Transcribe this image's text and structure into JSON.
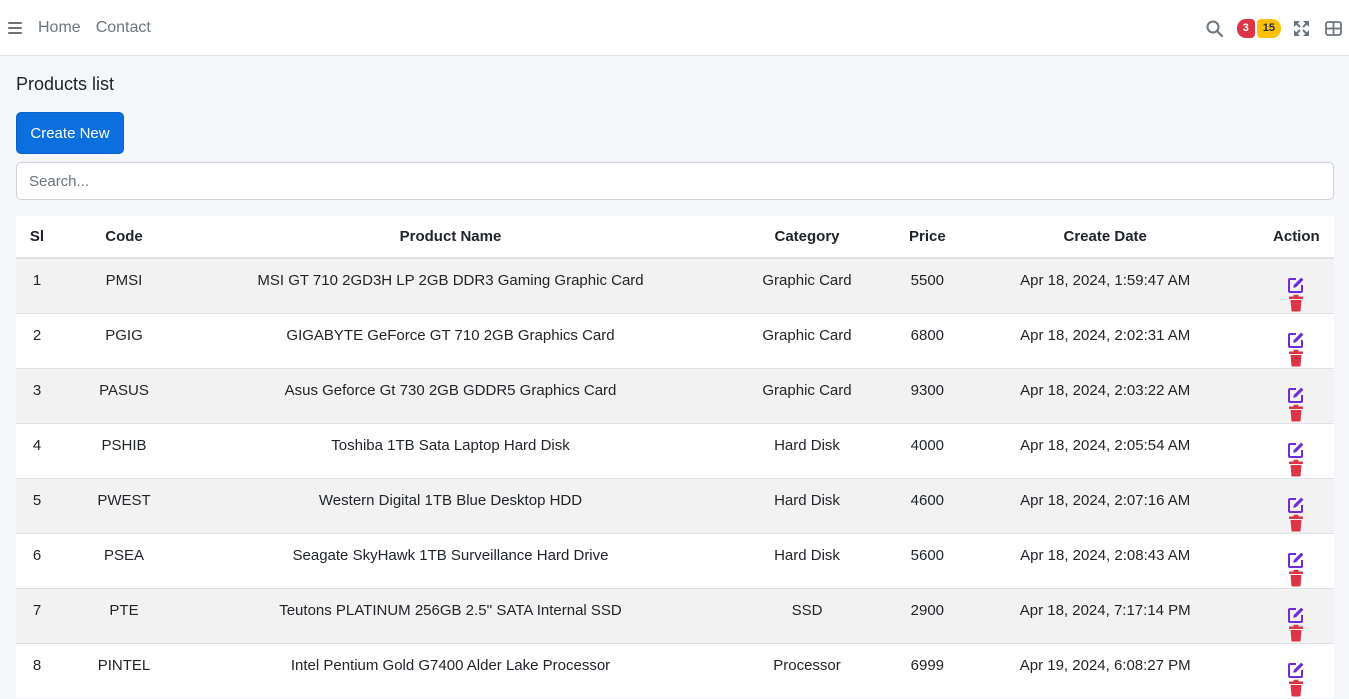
{
  "nav": {
    "links": [
      "Home",
      "Contact"
    ],
    "badge_messages": "3",
    "badge_notifications": "15"
  },
  "page": {
    "title": "Products list",
    "create_label": "Create New",
    "search_placeholder": "Search..."
  },
  "table": {
    "headers": [
      "Sl",
      "Code",
      "Product Name",
      "Category",
      "Price",
      "Create Date",
      "Action"
    ],
    "rows": [
      [
        "1",
        "PMSI",
        "MSI GT 710 2GD3H LP 2GB DDR3 Gaming Graphic Card",
        "Graphic Card",
        "5500",
        "Apr 18, 2024, 1:59:47 AM"
      ],
      [
        "2",
        "PGIG",
        "GIGABYTE GeForce GT 710 2GB Graphics Card",
        "Graphic Card",
        "6800",
        "Apr 18, 2024, 2:02:31 AM"
      ],
      [
        "3",
        "PASUS",
        "Asus Geforce Gt 730 2GB GDDR5 Graphics Card",
        "Graphic Card",
        "9300",
        "Apr 18, 2024, 2:03:22 AM"
      ],
      [
        "4",
        "PSHIB",
        "Toshiba 1TB Sata Laptop Hard Disk",
        "Hard Disk",
        "4000",
        "Apr 18, 2024, 2:05:54 AM"
      ],
      [
        "5",
        "PWEST",
        "Western Digital 1TB Blue Desktop HDD",
        "Hard Disk",
        "4600",
        "Apr 18, 2024, 2:07:16 AM"
      ],
      [
        "6",
        "PSEA",
        "Seagate SkyHawk 1TB Surveillance Hard Drive",
        "Hard Disk",
        "5600",
        "Apr 18, 2024, 2:08:43 AM"
      ],
      [
        "7",
        "PTE",
        "Teutons PLATINUM 256GB 2.5'' SATA Internal SSD",
        "SSD",
        "2900",
        "Apr 18, 2024, 7:17:14 PM"
      ],
      [
        "8",
        "PINTEL",
        "Intel Pentium Gold G7400 Alder Lake Processor",
        "Processor",
        "6999",
        "Apr 19, 2024, 6:08:27 PM"
      ]
    ],
    "row_actions": [
      "edit-icon",
      "trash-icon"
    ]
  },
  "colors": {
    "primary": "#0b6fe0",
    "edit": "#6f2bd9",
    "delete": "#dc3545",
    "badge_danger": "#dc3545",
    "badge_warning": "#ffc107"
  }
}
